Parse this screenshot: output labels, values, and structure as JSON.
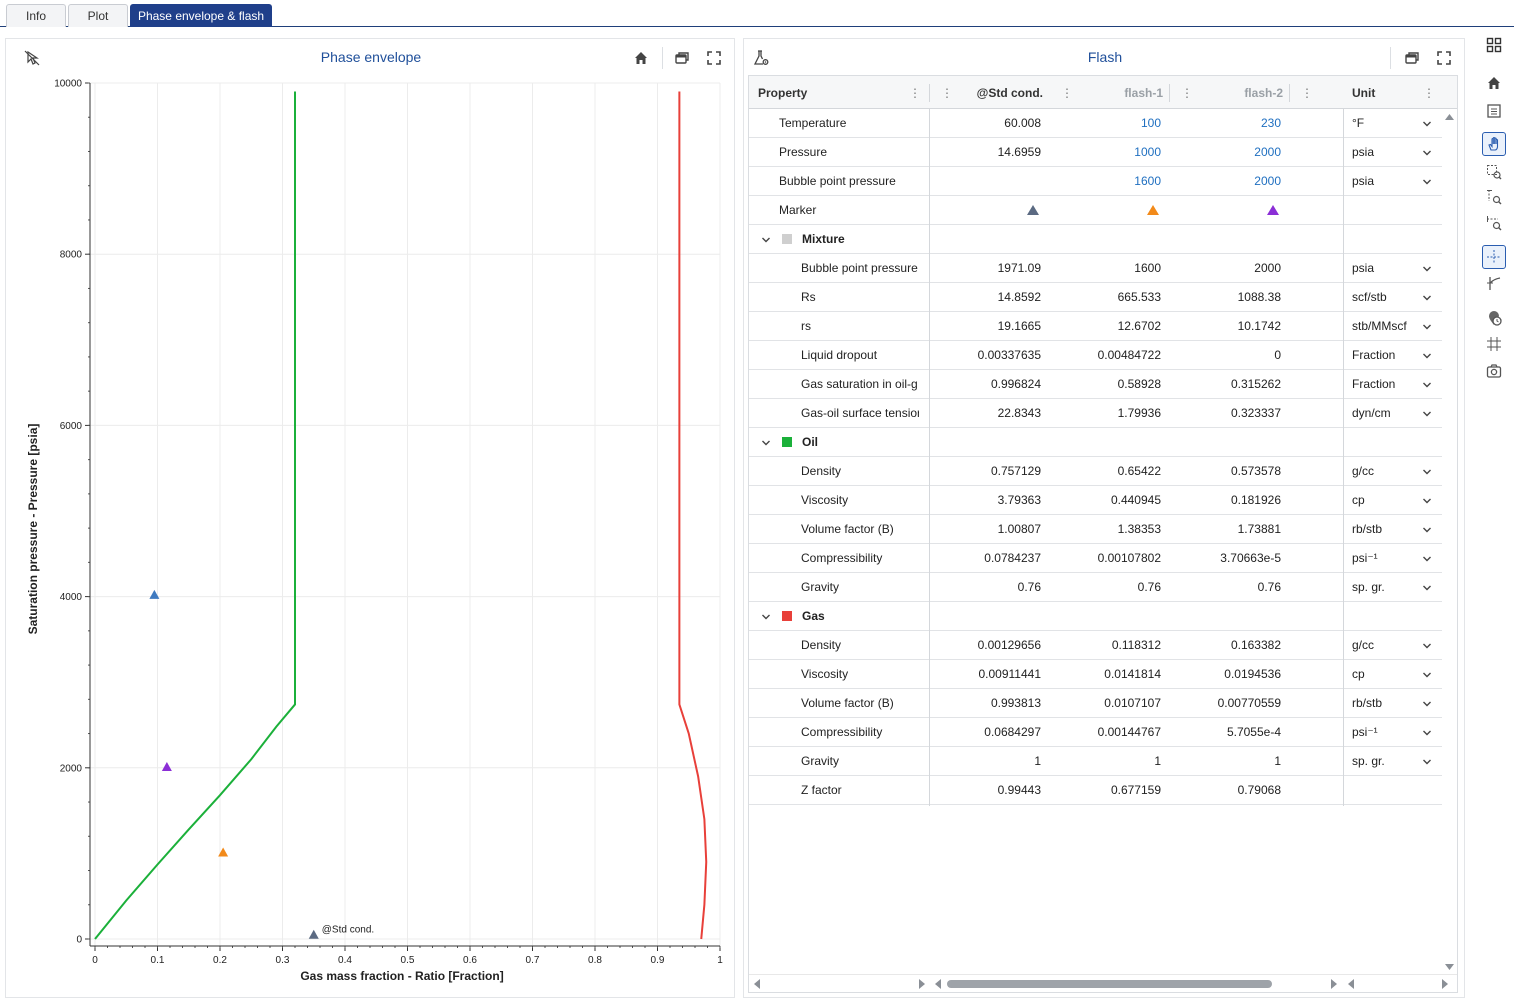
{
  "tabs": [
    {
      "label": "Info",
      "active": false
    },
    {
      "label": "Plot",
      "active": false
    },
    {
      "label": "Phase envelope & flash",
      "active": true
    }
  ],
  "phase_panel": {
    "title": "Phase envelope"
  },
  "flash_panel": {
    "title": "Flash"
  },
  "chart_data": {
    "type": "line",
    "title": "Phase envelope",
    "xlabel": "Gas mass fraction - Ratio [Fraction]",
    "ylabel": "Saturation pressure - Pressure [psia]",
    "xlim": [
      0,
      1
    ],
    "ylim": [
      0,
      10000
    ],
    "xticks": [
      "0",
      "0.1",
      "0.2",
      "0.3",
      "0.4",
      "0.5",
      "0.6",
      "0.7",
      "0.8",
      "0.9",
      "1"
    ],
    "yticks": [
      "0",
      "2000",
      "4000",
      "6000",
      "8000",
      "10000"
    ],
    "grid": true,
    "series": [
      {
        "color": "#1bb03a",
        "x": [
          0.0,
          0.05,
          0.1,
          0.15,
          0.2,
          0.25,
          0.29,
          0.32,
          0.32,
          0.32
        ],
        "y": [
          0,
          450,
          870,
          1280,
          1680,
          2100,
          2480,
          2740,
          5000,
          9900
        ]
      },
      {
        "color": "#e8403a",
        "x": [
          0.97,
          0.975,
          0.978,
          0.975,
          0.965,
          0.95,
          0.935,
          0.935,
          0.935
        ],
        "y": [
          0,
          400,
          900,
          1400,
          1900,
          2400,
          2740,
          5000,
          9900
        ]
      }
    ],
    "markers": [
      {
        "x": 0.35,
        "y": 50,
        "color": "#5b6a82",
        "label": "@Std cond."
      },
      {
        "x": 0.095,
        "y": 4020,
        "color": "#3f7ac0",
        "label": ""
      },
      {
        "x": 0.115,
        "y": 2010,
        "color": "#8b2ed6",
        "label": ""
      },
      {
        "x": 0.205,
        "y": 1010,
        "color": "#f28a1a",
        "label": ""
      }
    ]
  },
  "flash_table": {
    "columns": [
      "Property",
      "@Std cond.",
      "flash-1",
      "flash-2",
      "Unit"
    ],
    "rows": [
      {
        "type": "prop",
        "label": "Temperature",
        "std": "60.008",
        "f1": "100",
        "f2": "230",
        "unit": "°F",
        "editable": true
      },
      {
        "type": "prop",
        "label": "Pressure",
        "std": "14.6959",
        "f1": "1000",
        "f2": "2000",
        "unit": "psia",
        "editable": true
      },
      {
        "type": "prop",
        "label": "Bubble point pressure",
        "std": "",
        "f1": "1600",
        "f2": "2000",
        "unit": "psia",
        "editable": true
      },
      {
        "type": "marker",
        "label": "Marker",
        "colors": [
          "#5b6a82",
          "#f28a1a",
          "#8b2ed6"
        ]
      },
      {
        "type": "group",
        "label": "Mixture",
        "color": "#cfcfcf"
      },
      {
        "type": "sub",
        "label": "Bubble point pressure",
        "std": "1971.09",
        "f1": "1600",
        "f2": "2000",
        "unit": "psia"
      },
      {
        "type": "sub",
        "label": "Rs",
        "std": "14.8592",
        "f1": "665.533",
        "f2": "1088.38",
        "unit": "scf/stb"
      },
      {
        "type": "sub",
        "label": "rs",
        "std": "19.1665",
        "f1": "12.6702",
        "f2": "10.1742",
        "unit": "stb/MMscf"
      },
      {
        "type": "sub",
        "label": "Liquid dropout",
        "std": "0.00337635",
        "f1": "0.00484722",
        "f2": "0",
        "unit": "Fraction"
      },
      {
        "type": "sub",
        "label": "Gas saturation in oil-g",
        "std": "0.996824",
        "f1": "0.58928",
        "f2": "0.315262",
        "unit": "Fraction"
      },
      {
        "type": "sub",
        "label": "Gas-oil surface tensior",
        "std": "22.8343",
        "f1": "1.79936",
        "f2": "0.323337",
        "unit": "dyn/cm"
      },
      {
        "type": "group",
        "label": "Oil",
        "color": "#1bb03a"
      },
      {
        "type": "sub",
        "label": "Density",
        "std": "0.757129",
        "f1": "0.65422",
        "f2": "0.573578",
        "unit": "g/cc"
      },
      {
        "type": "sub",
        "label": "Viscosity",
        "std": "3.79363",
        "f1": "0.440945",
        "f2": "0.181926",
        "unit": "cp"
      },
      {
        "type": "sub",
        "label": "Volume factor (B)",
        "std": "1.00807",
        "f1": "1.38353",
        "f2": "1.73881",
        "unit": "rb/stb"
      },
      {
        "type": "sub",
        "label": "Compressibility",
        "std": "0.0784237",
        "f1": "0.00107802",
        "f2": "3.70663e-5",
        "unit": "psi⁻¹"
      },
      {
        "type": "sub",
        "label": "Gravity",
        "std": "0.76",
        "f1": "0.76",
        "f2": "0.76",
        "unit": "sp. gr."
      },
      {
        "type": "group",
        "label": "Gas",
        "color": "#e8403a"
      },
      {
        "type": "sub",
        "label": "Density",
        "std": "0.00129656",
        "f1": "0.118312",
        "f2": "0.163382",
        "unit": "g/cc"
      },
      {
        "type": "sub",
        "label": "Viscosity",
        "std": "0.00911441",
        "f1": "0.0141814",
        "f2": "0.0194536",
        "unit": "cp"
      },
      {
        "type": "sub",
        "label": "Volume factor (B)",
        "std": "0.993813",
        "f1": "0.0107107",
        "f2": "0.00770559",
        "unit": "rb/stb"
      },
      {
        "type": "sub",
        "label": "Compressibility",
        "std": "0.0684297",
        "f1": "0.00144767",
        "f2": "5.7055e-4",
        "unit": "psi⁻¹"
      },
      {
        "type": "sub",
        "label": "Gravity",
        "std": "1",
        "f1": "1",
        "f2": "1",
        "unit": "sp. gr."
      },
      {
        "type": "sub",
        "label": "Z factor",
        "std": "0.99443",
        "f1": "0.677159",
        "f2": "0.79068",
        "unit": ""
      }
    ]
  },
  "toolbar": {
    "items": [
      "grid-layout-icon",
      "home-icon",
      "list-icon",
      "pan-hand-icon",
      "box-zoom-icon",
      "y-zoom-icon",
      "x-zoom-icon",
      "crosshair-icon",
      "probe-icon",
      "hover-icon",
      "grid-icon",
      "camera-icon"
    ]
  }
}
